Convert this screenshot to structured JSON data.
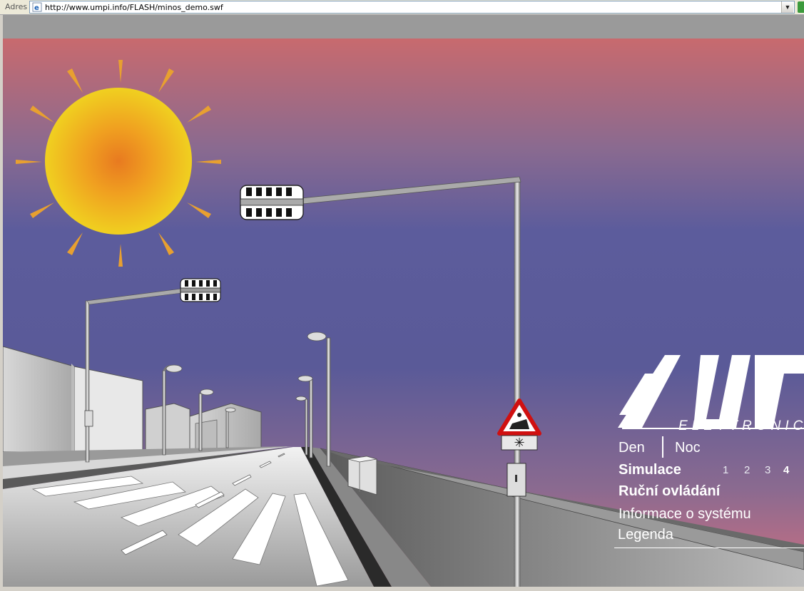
{
  "address_bar": {
    "label": "Adres",
    "url": "http://www.umpi.info/FLASH/minos_demo.swf"
  },
  "scene": {
    "sign_symbol": "✳"
  },
  "logo": {
    "text": "ELETTRONIC"
  },
  "menu": {
    "den": "Den",
    "noc": "Noc",
    "simulace": "Simulace",
    "steps": [
      "1",
      "2",
      "3",
      "4"
    ],
    "active_step": "4",
    "rucni": "Ruční ovládání",
    "info": "Informace o systému",
    "legenda": "Legenda"
  },
  "colors": {
    "sky_top": "#c86a6e",
    "sky_mid": "#5a5a9a",
    "sky_bottom": "#c86a7a",
    "sun": "#f0c020",
    "sun_core": "#e88a20"
  }
}
